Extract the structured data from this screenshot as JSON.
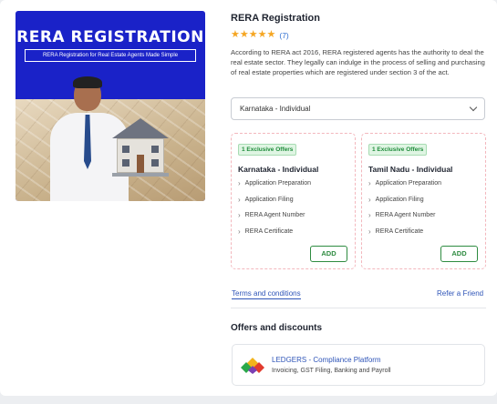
{
  "hero": {
    "title": "RERA REGISTRATION",
    "subtitle": "RERA Registration for Real Estate Agents Made Simple"
  },
  "product": {
    "title": "RERA Registration",
    "rating": 5,
    "rating_count": "(7)",
    "description": "According to RERA act 2016, RERA registered agents has the authority to deal the real estate sector. They legally can indulge in the process of selling and purchasing of real estate properties which are registered under section 3 of the act."
  },
  "selector": {
    "value": "Karnataka - Individual"
  },
  "offers": [
    {
      "badge": "1 Exclusive Offers",
      "title": "Karnataka - Individual",
      "features": [
        "Application Preparation",
        "Application Filing",
        "RERA Agent Number",
        "RERA Certificate"
      ],
      "add_label": "ADD"
    },
    {
      "badge": "1 Exclusive Offers",
      "title": "Tamil Nadu - Individual",
      "features": [
        "Application Preparation",
        "Application Filing",
        "RERA Agent Number",
        "RERA Certificate"
      ],
      "add_label": "ADD"
    }
  ],
  "links": {
    "terms": "Terms and conditions",
    "refer": "Refer a Friend"
  },
  "discounts": {
    "heading": "Offers and discounts",
    "promo_title": "LEDGERS - Compliance Platform",
    "promo_subtitle": "Invoicing, GST Filing, Banking and Payroll"
  },
  "colors": {
    "accent_blue": "#2f55b8",
    "add_green": "#2e8b40",
    "star": "#f5a623",
    "hero_bg": "#1a22c8"
  }
}
